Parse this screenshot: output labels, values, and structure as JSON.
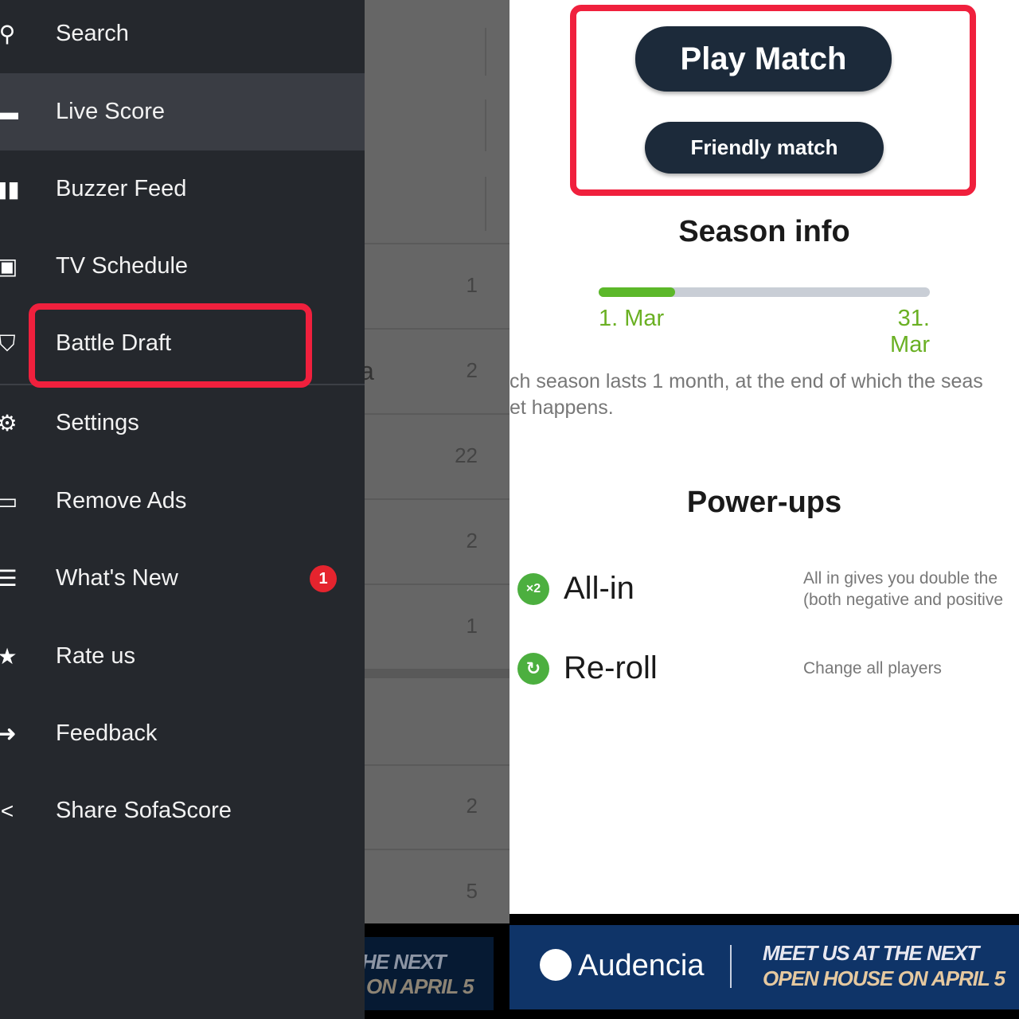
{
  "drawer": {
    "items": [
      {
        "label": "Search",
        "icon": "search-icon"
      },
      {
        "label": "Live Score",
        "icon": "live-score-icon",
        "active": true
      },
      {
        "label": "Buzzer Feed",
        "icon": "buzzer-feed-icon"
      },
      {
        "label": "TV Schedule",
        "icon": "tv-icon"
      },
      {
        "label": "Battle Draft",
        "icon": "battle-draft-icon",
        "highlighted": true
      },
      {
        "label": "Settings",
        "icon": "gear-icon"
      },
      {
        "label": "Remove Ads",
        "icon": "card-icon"
      },
      {
        "label": "What's New",
        "icon": "message-icon",
        "badge": "1"
      },
      {
        "label": "Rate us",
        "icon": "star-icon"
      },
      {
        "label": "Feedback",
        "icon": "arrow-right-icon"
      },
      {
        "label": "Share SofaScore",
        "icon": "share-icon"
      }
    ]
  },
  "background_list": {
    "values": [
      "1",
      "2",
      "22",
      "2",
      "1",
      "2",
      "5"
    ],
    "partial_text": "a"
  },
  "left_ad": {
    "line1": "HE NEXT",
    "line2": "ON APRIL 5"
  },
  "match": {
    "play_label": "Play Match",
    "friendly_label": "Friendly match"
  },
  "season": {
    "title": "Season info",
    "start": "1. Mar",
    "end": "31. Mar",
    "progress": 0.23,
    "description_line1": "ch season lasts 1 month, at the end of which the seas",
    "description_line2": "et happens."
  },
  "powerups": {
    "title": "Power-ups",
    "items": [
      {
        "name": "All-in",
        "icon_text": "×2",
        "description_line1": "All in gives you double the",
        "description_line2": "(both negative and positive"
      },
      {
        "name": "Re-roll",
        "icon_text": "↻",
        "description_line1": "Change all players",
        "description_line2": ""
      }
    ]
  },
  "ad": {
    "brand": "Audencia",
    "line1": "MEET US AT THE NEXT",
    "line2": "OPEN HOUSE ON APRIL 5"
  },
  "colors": {
    "highlight": "#f0203d",
    "button": "#1c2a3a",
    "green": "#6ab023",
    "drawer": "#25282d"
  }
}
